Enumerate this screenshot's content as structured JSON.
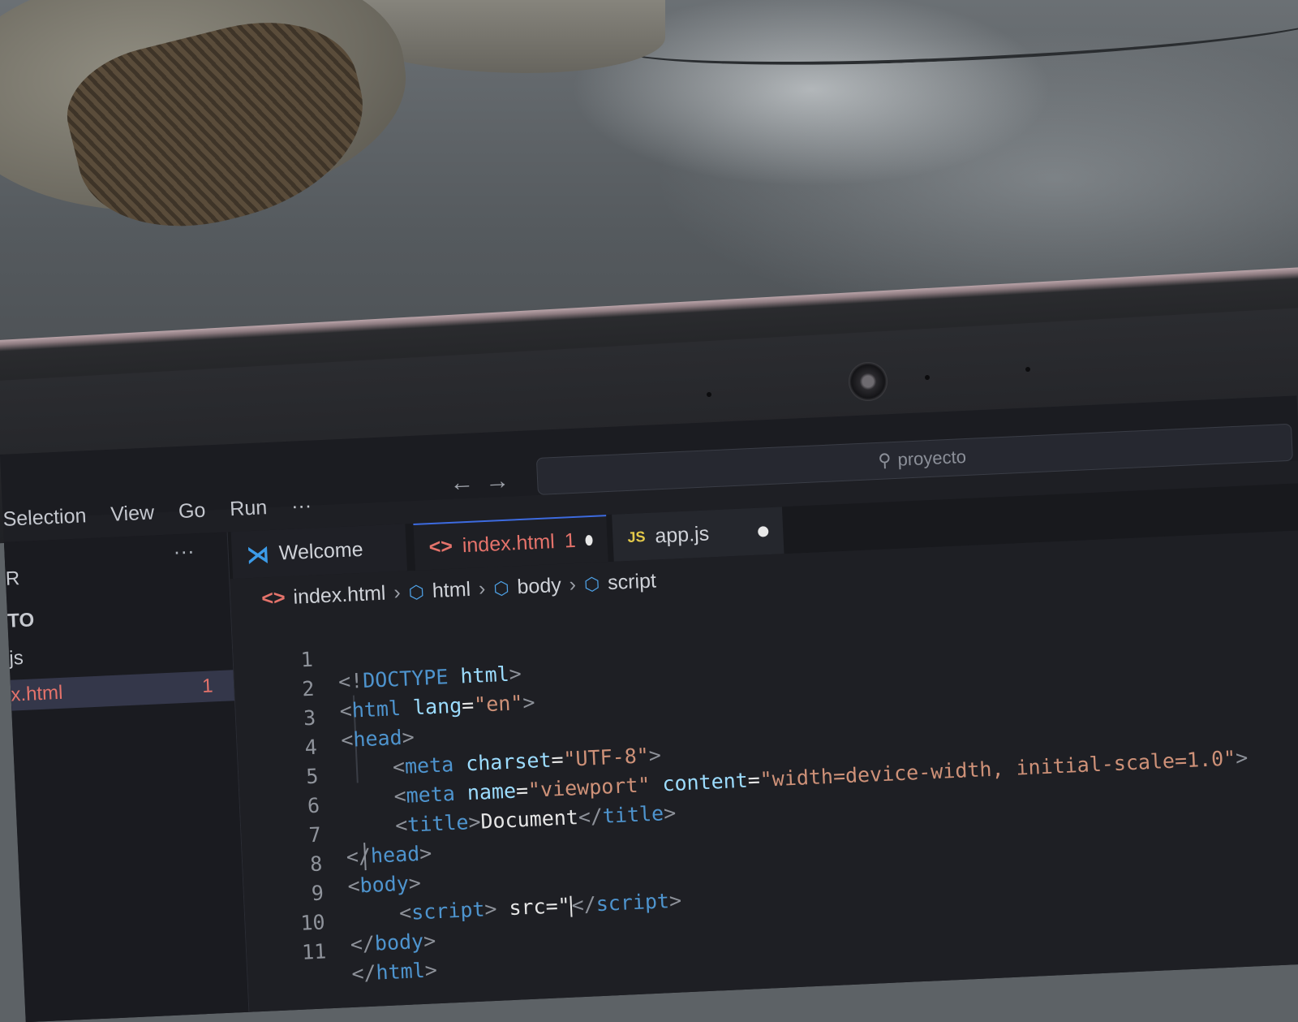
{
  "menu": [
    "Selection",
    "View",
    "Go",
    "Run",
    "···"
  ],
  "search": {
    "label": "proyecto"
  },
  "sidebar": {
    "more": "···",
    "items": [
      {
        "label": "R"
      },
      {
        "label": "TO"
      },
      {
        "label": "js"
      },
      {
        "label": "x.html",
        "badge": "1"
      }
    ]
  },
  "tabs": {
    "welcome": {
      "label": "Welcome"
    },
    "index": {
      "label": "index.html",
      "problems": "1"
    },
    "app": {
      "badge": "JS",
      "label": "app.js"
    }
  },
  "breadcrumb": [
    "index.html",
    "html",
    "body",
    "script"
  ],
  "colors": {
    "active_tab_text": "#e5736b",
    "tag": "#4e94ce",
    "string": "#ce9178",
    "attribute": "#9cdcfe"
  },
  "code": {
    "line_numbers": [
      "1",
      "2",
      "3",
      "4",
      "5",
      "6",
      "7",
      "8",
      "9",
      "10",
      "11"
    ],
    "l1": {
      "open": "<!",
      "tag": "DOCTYPE",
      "rest": " html",
      "close": ">"
    },
    "l2": {
      "open": "<",
      "tag": "html",
      "attr": " lang",
      "eq": "=",
      "val": "\"en\"",
      "close": ">"
    },
    "l3": {
      "open": "<",
      "tag": "head",
      "close": ">"
    },
    "l4": {
      "open": "<",
      "tag": "meta",
      "attr": " charset",
      "eq": "=",
      "val": "\"UTF-8\"",
      "close": ">"
    },
    "l5": {
      "open": "<",
      "tag": "meta",
      "attr1": " name",
      "eq1": "=",
      "val1": "\"viewport\"",
      "attr2": " content",
      "eq2": "=",
      "val2": "\"width=device-width, initial-scale=1.0\"",
      "close": ">"
    },
    "l6": {
      "open": "<",
      "tag": "title",
      "close": ">",
      "text": "Document",
      "open2": "</",
      "tag2": "title",
      "close2": ">"
    },
    "l7": {
      "open": "</",
      "tag": "head",
      "close": ">"
    },
    "l8": {
      "open": "<",
      "tag": "body",
      "close": ">"
    },
    "l9": {
      "open": "<",
      "tag": "script",
      "close": ">",
      "text": " src=\"",
      "open2": "</",
      "tag2": "script",
      "close2": ">"
    },
    "l10": {
      "open": "</",
      "tag": "body",
      "close": ">"
    },
    "l11": {
      "open": "</",
      "tag": "html",
      "close": ">"
    }
  }
}
